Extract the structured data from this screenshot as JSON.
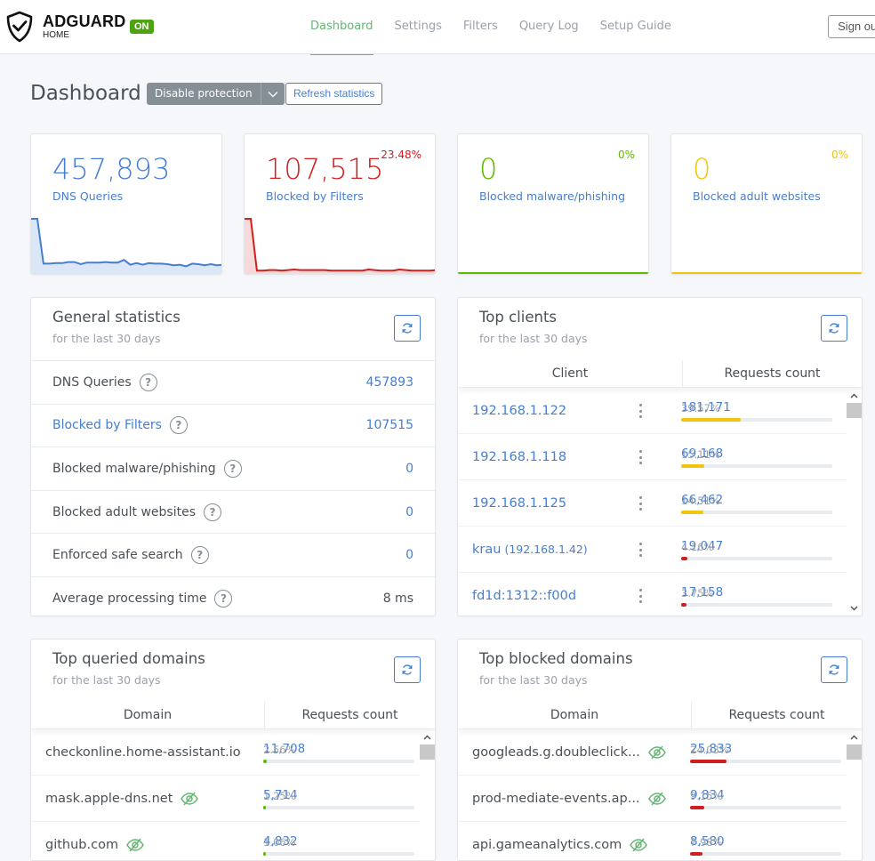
{
  "header": {
    "brand": "ADGUARD",
    "brand_sub": "HOME",
    "status_badge": "ON",
    "nav": [
      {
        "label": "Dashboard",
        "active": true
      },
      {
        "label": "Settings",
        "active": false
      },
      {
        "label": "Filters",
        "active": false
      },
      {
        "label": "Query Log",
        "active": false
      },
      {
        "label": "Setup Guide",
        "active": false
      }
    ],
    "signout_label": "Sign out"
  },
  "page": {
    "title": "Dashboard",
    "disable_protection_label": "Disable protection",
    "refresh_statistics_label": "Refresh statistics"
  },
  "colors": {
    "blue": "#467fcf",
    "red": "#cd201f",
    "green": "#5eba00",
    "yellow": "#f1c40f",
    "accent_nav": "#66b574"
  },
  "stat_cards": [
    {
      "value": "457,893",
      "label": "DNS Queries",
      "percent": "",
      "color": "#467fcf",
      "fill": "#dbe6f6",
      "sparkline": [
        100,
        100,
        16,
        16,
        17,
        17,
        19,
        19,
        15,
        18,
        18,
        18,
        19,
        18,
        18,
        23,
        14,
        17,
        14,
        17,
        16,
        16,
        15,
        13,
        14,
        11,
        16,
        15,
        13,
        15,
        13,
        14
      ]
    },
    {
      "value": "107,515",
      "label": "Blocked by Filters",
      "percent": "23.48%",
      "color": "#cd201f",
      "fill": "#f7d9d9",
      "sparkline": [
        100,
        100,
        3,
        3,
        4,
        4,
        3,
        4,
        5,
        4,
        4,
        4,
        4,
        4,
        3,
        3,
        3,
        3,
        3,
        3,
        5,
        4,
        3,
        3,
        3,
        5,
        4,
        3,
        3,
        3,
        3,
        4
      ]
    },
    {
      "value": "0",
      "label": "Blocked malware/phishing",
      "percent": "0%",
      "color": "#5eba00"
    },
    {
      "value": "0",
      "label": "Blocked adult websites",
      "percent": "0%",
      "color": "#f1c40f"
    }
  ],
  "general_statistics": {
    "title": "General statistics",
    "subtitle": "for the last 30 days",
    "rows": [
      {
        "label": "DNS Queries",
        "value": "457893",
        "link": false,
        "plain": false
      },
      {
        "label": "Blocked by Filters",
        "value": "107515",
        "link": true,
        "plain": false
      },
      {
        "label": "Blocked malware/phishing",
        "value": "0",
        "link": false,
        "plain": false
      },
      {
        "label": "Blocked adult websites",
        "value": "0",
        "link": false,
        "plain": false
      },
      {
        "label": "Enforced safe search",
        "value": "0",
        "link": false,
        "plain": false
      },
      {
        "label": "Average processing time",
        "value": "8 ms",
        "link": false,
        "plain": true
      }
    ]
  },
  "top_clients": {
    "title": "Top clients",
    "subtitle": "for the last 30 days",
    "columns": [
      "Client",
      "Requests count"
    ],
    "rows": [
      {
        "name": "192.168.1.122",
        "sub": "",
        "count": "181,171",
        "percent": "39.57%",
        "fraction": 0.3957,
        "bar_color": "#f1c40f"
      },
      {
        "name": "192.168.1.118",
        "sub": "",
        "count": "69,168",
        "percent": "15.11%",
        "fraction": 0.1511,
        "bar_color": "#f1c40f"
      },
      {
        "name": "192.168.1.125",
        "sub": "",
        "count": "66,462",
        "percent": "14.51%",
        "fraction": 0.1451,
        "bar_color": "#f1c40f"
      },
      {
        "name": "krau",
        "sub": "(192.168.1.42)",
        "count": "19,047",
        "percent": "4.16%",
        "fraction": 0.0416,
        "bar_color": "#cd201f"
      },
      {
        "name": "fd1d:1312::f00d",
        "sub": "",
        "count": "17,158",
        "percent": "3.75%",
        "fraction": 0.0375,
        "bar_color": "#cd201f"
      }
    ]
  },
  "top_queried": {
    "title": "Top queried domains",
    "subtitle": "for the last 30 days",
    "columns": [
      "Domain",
      "Requests count"
    ],
    "rows": [
      {
        "name": "checkonline.home-assistant.io",
        "eye": false,
        "count": "11,708",
        "percent": "2.56%",
        "fraction": 0.0256,
        "bar_color": "#5eba00"
      },
      {
        "name": "mask.apple-dns.net",
        "eye": true,
        "count": "5,714",
        "percent": "1.25%",
        "fraction": 0.0125,
        "bar_color": "#5eba00"
      },
      {
        "name": "github.com",
        "eye": true,
        "count": "4,832",
        "percent": "1.06%",
        "fraction": 0.0106,
        "bar_color": "#5eba00"
      }
    ]
  },
  "top_blocked": {
    "title": "Top blocked domains",
    "subtitle": "for the last 30 days",
    "columns": [
      "Domain",
      "Requests count"
    ],
    "rows": [
      {
        "name": "googleads.g.doubleclick...",
        "eye": true,
        "count": "25,833",
        "percent": "24.03%",
        "fraction": 0.2403,
        "bar_color": "#cd201f"
      },
      {
        "name": "prod-mediate-events.ap...",
        "eye": true,
        "count": "9,834",
        "percent": "9.15%",
        "fraction": 0.0915,
        "bar_color": "#cd201f"
      },
      {
        "name": "api.gameanalytics.com",
        "eye": true,
        "count": "8,580",
        "percent": "7.98%",
        "fraction": 0.0798,
        "bar_color": "#cd201f"
      }
    ]
  }
}
